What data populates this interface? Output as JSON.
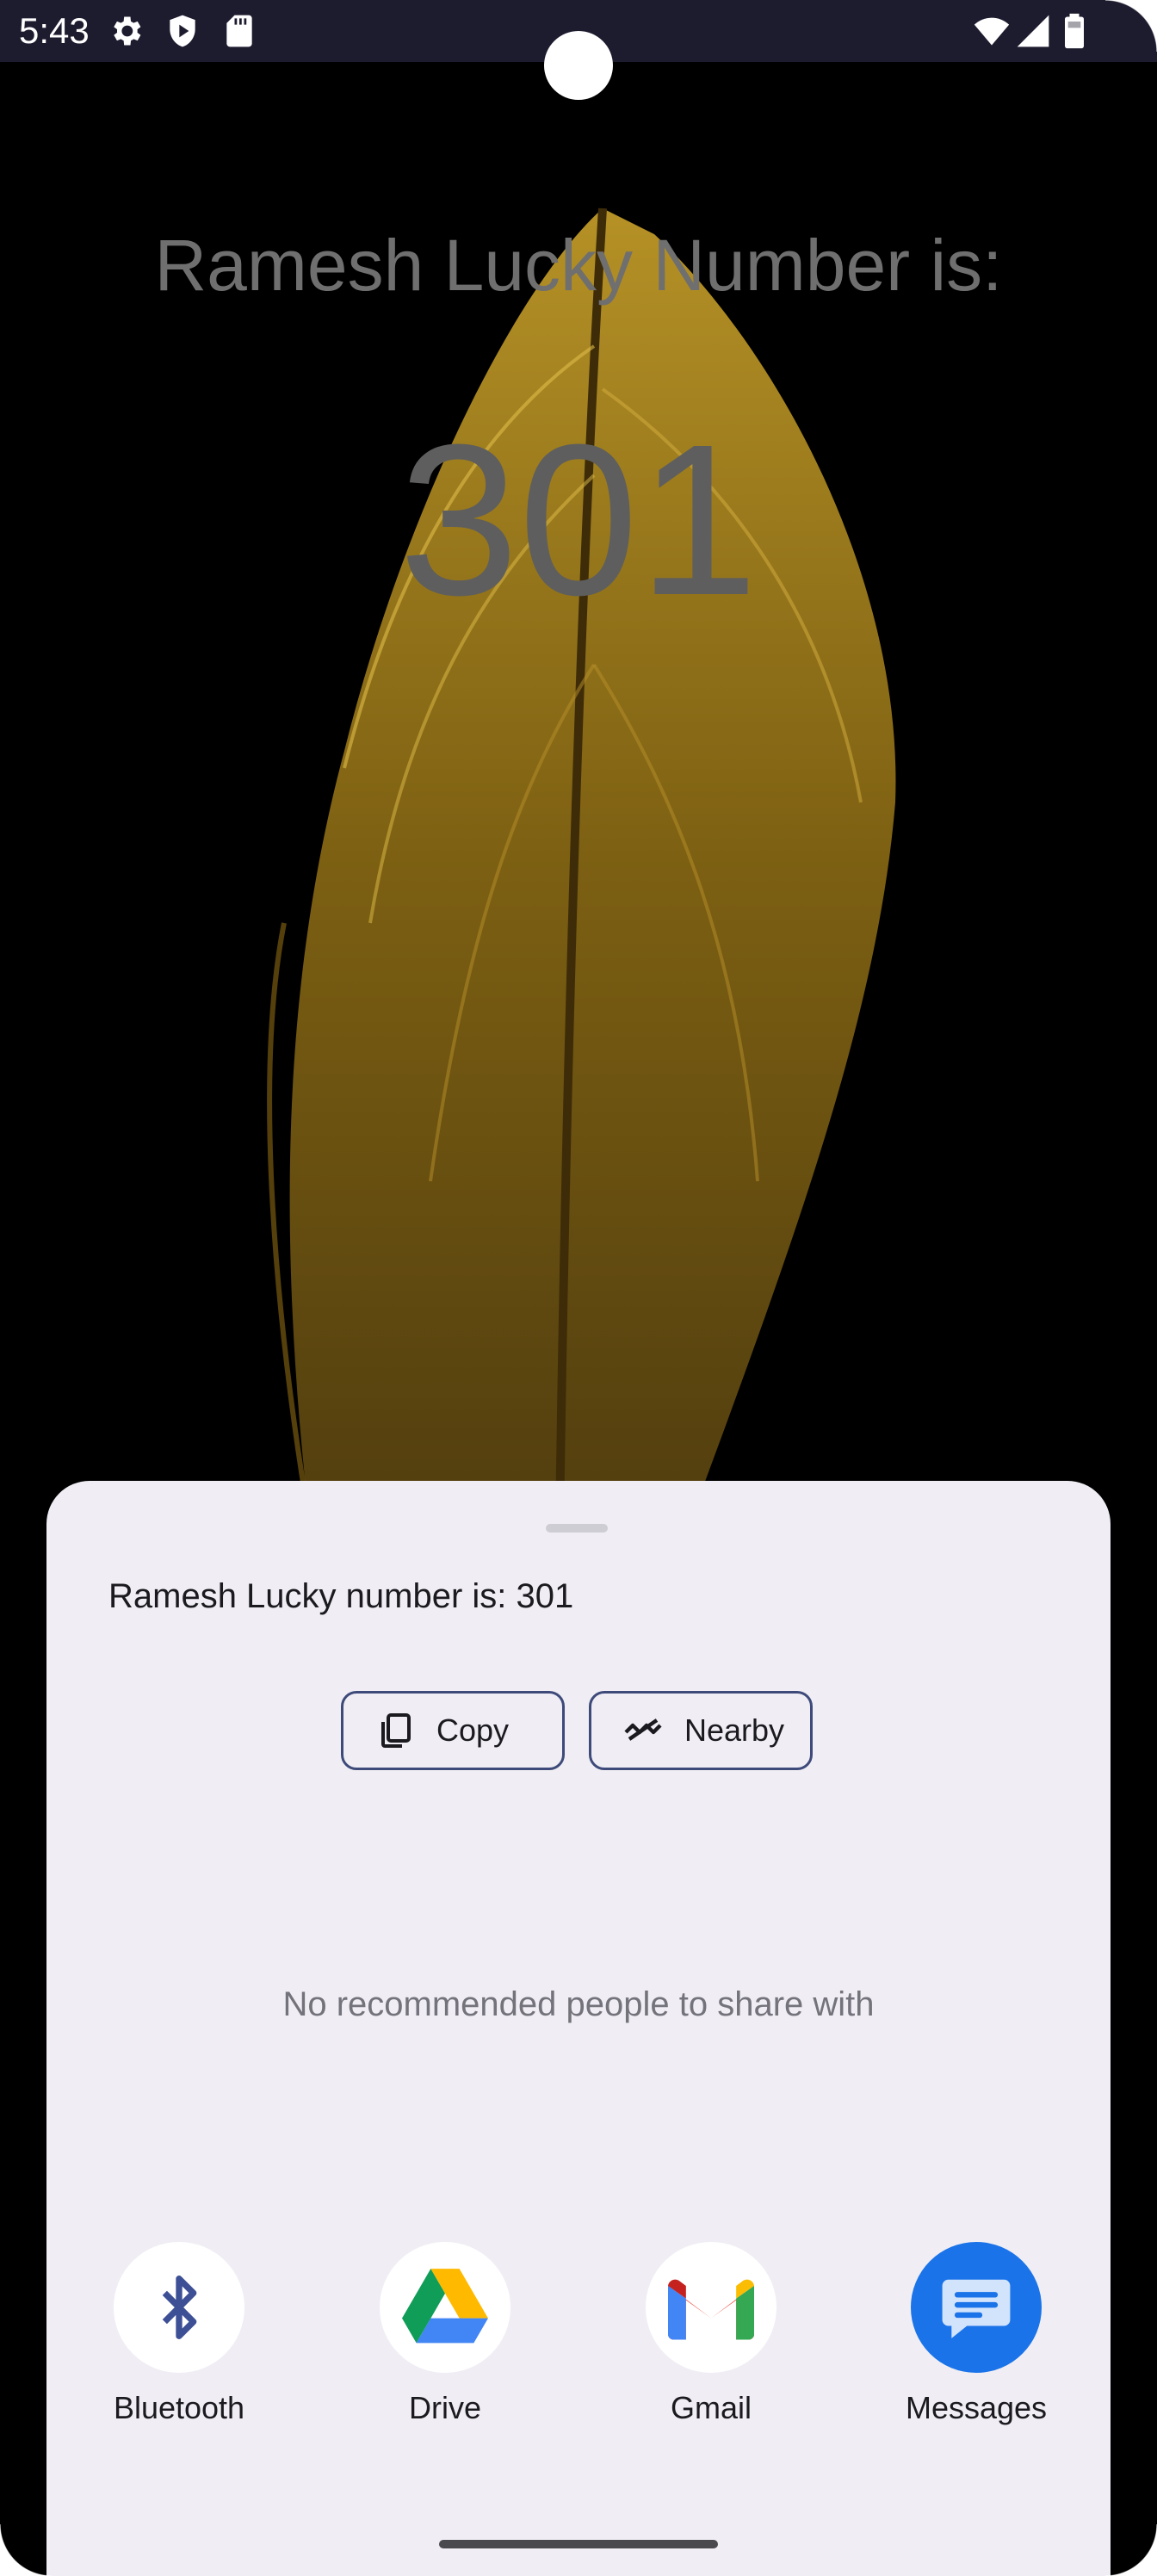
{
  "status_bar": {
    "time": "5:43",
    "icons": [
      "gear-icon",
      "shield-icon",
      "sd-card-icon",
      "wifi-icon",
      "signal-icon",
      "battery-icon"
    ]
  },
  "app": {
    "title": "Ramesh Lucky Number is:",
    "number": "301"
  },
  "share_sheet": {
    "preview_text": "Ramesh Lucky number is: 301",
    "actions": [
      {
        "label": "Copy",
        "icon": "copy-icon"
      },
      {
        "label": "Nearby",
        "icon": "nearby-share-icon"
      }
    ],
    "empty_people_message": "No recommended people to share with",
    "targets": [
      {
        "label": "Bluetooth",
        "icon": "bluetooth-icon"
      },
      {
        "label": "Drive",
        "icon": "google-drive-icon"
      },
      {
        "label": "Gmail",
        "icon": "gmail-icon"
      },
      {
        "label": "Messages",
        "icon": "messages-icon"
      }
    ]
  },
  "colors": {
    "status_bar_bg": "#1d1b2e",
    "sheet_bg": "#f0eef4",
    "chip_border": "#3e4a7a",
    "messages_blue": "#1a73e8"
  }
}
